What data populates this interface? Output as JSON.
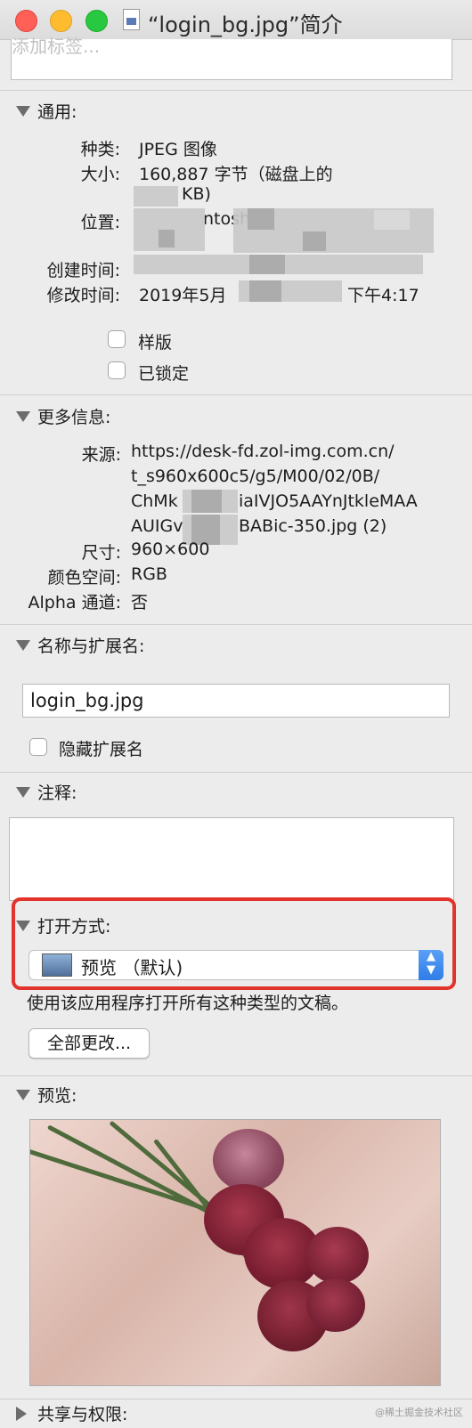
{
  "window": {
    "title": "“login_bg.jpg”简介"
  },
  "tags": {
    "placeholder": "添加标签..."
  },
  "general": {
    "header": "通用:",
    "kind_label": "种类:",
    "kind_value": "JPEG 图像",
    "size_label": "大小:",
    "size_value": "160,887 字节（磁盘上的",
    "size_value_line2": "KB)",
    "where_label": "位置:",
    "where_value": "ntosh",
    "created_label": "创建时间:",
    "modified_label": "修改时间:",
    "modified_value": "2019年5月",
    "modified_time": "下午4:17",
    "stationery_label": "样版",
    "locked_label": "已锁定"
  },
  "more_info": {
    "header": "更多信息:",
    "source_label": "来源:",
    "source_lines": [
      "https://desk-fd.zol-img.com.cn/",
      "t_s960x600c5/g5/M00/02/0B/",
      "ChMk",
      "AUIGv"
    ],
    "source_line3_tail": "iaIVJO5AAYnJtkleMAA",
    "source_line4_tail": "BABic-350.jpg (2)",
    "dimensions_label": "尺寸:",
    "dimensions_value": "960×600",
    "color_space_label": "颜色空间:",
    "color_space_value": "RGB",
    "alpha_label": "Alpha 通道:",
    "alpha_value": "否"
  },
  "name_ext": {
    "header": "名称与扩展名:",
    "filename": "login_bg.jpg",
    "hide_ext_label": "隐藏扩展名"
  },
  "comments": {
    "header": "注释:"
  },
  "open_with": {
    "header": "打开方式:",
    "app": "预览 （默认)",
    "description": "使用该应用程序打开所有这种类型的文稿。",
    "change_all_button": "全部更改..."
  },
  "preview": {
    "header": "预览:"
  },
  "sharing": {
    "header": "共享与权限:"
  },
  "watermark": "@稀土掘金技术社区",
  "colors": {
    "highlight": "#e2332c",
    "accent": "#2f7ce6"
  }
}
